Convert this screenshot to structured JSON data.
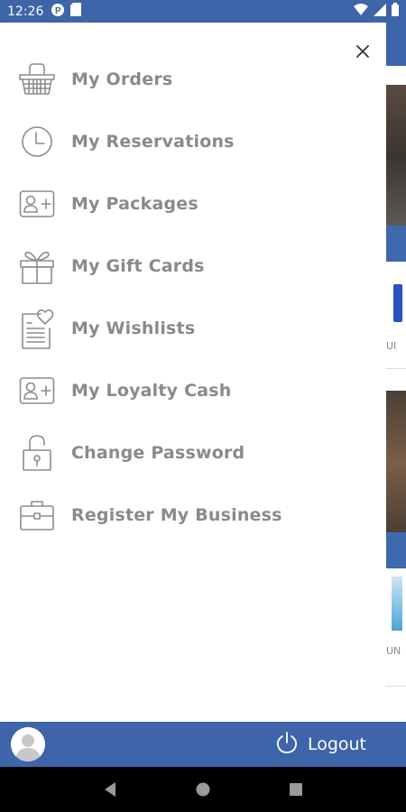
{
  "status_bar": {
    "time": "12:26",
    "icons_left": [
      "notification-p-icon",
      "sd-card-icon"
    ],
    "icons_right": [
      "wifi-icon",
      "signal-icon",
      "battery-icon"
    ]
  },
  "drawer": {
    "close_icon": "close-icon",
    "menu": [
      {
        "label": "My Orders",
        "icon": "basket-icon"
      },
      {
        "label": "My Reservations",
        "icon": "clock-icon"
      },
      {
        "label": "My Packages",
        "icon": "add-user-card-icon"
      },
      {
        "label": "My Gift Cards",
        "icon": "gift-icon"
      },
      {
        "label": "My Wishlists",
        "icon": "wishlist-icon"
      },
      {
        "label": "My Loyalty Cash",
        "icon": "add-user-card-icon"
      },
      {
        "label": "Change Password",
        "icon": "unlock-icon"
      },
      {
        "label": "Register My Business",
        "icon": "briefcase-icon"
      }
    ]
  },
  "background_peek": {
    "text_1": "UI",
    "text_2": "UN"
  },
  "bottom_bar": {
    "logout_label": "Logout"
  },
  "colors": {
    "primary": "#3e64aa",
    "menu_text": "#8a8a8a",
    "icon_stroke": "#8c8c8c"
  }
}
